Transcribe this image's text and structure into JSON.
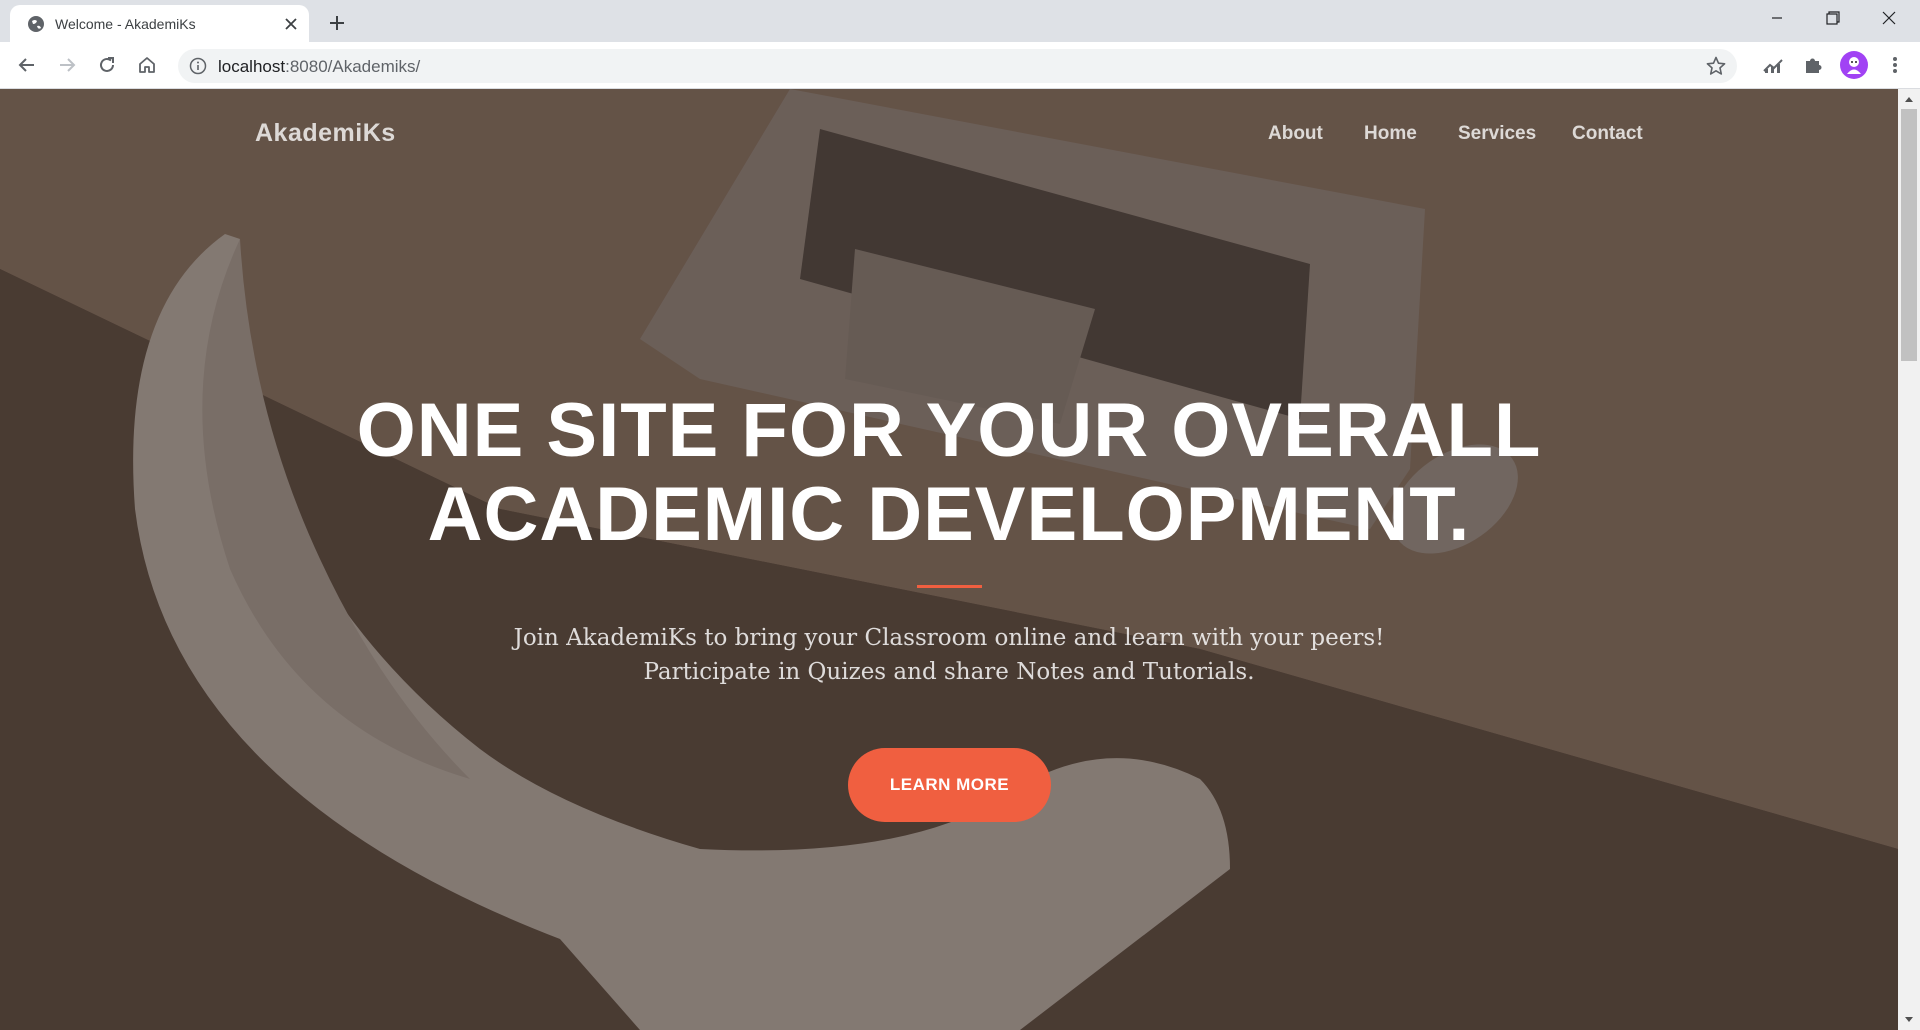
{
  "browser": {
    "tab_title": "Welcome - AkademiKs",
    "url_host": "localhost",
    "url_rest": ":8080/Akademiks/",
    "icons": [
      "globe-icon",
      "close-icon",
      "plus-icon",
      "minimize-icon",
      "restore-icon",
      "close-window-icon",
      "back-icon",
      "forward-icon",
      "reload-icon",
      "home-icon",
      "info-icon",
      "star-icon",
      "chart-extension-icon",
      "puzzle-icon",
      "profile-avatar",
      "menu-dots-icon"
    ]
  },
  "page": {
    "brand": "AkademiKs",
    "nav": [
      {
        "label": "About"
      },
      {
        "label": "Home"
      },
      {
        "label": "Services"
      },
      {
        "label": "Contact"
      }
    ],
    "hero": {
      "title_line1": "ONE SITE FOR YOUR OVERALL",
      "title_line2": "ACADEMIC DEVELOPMENT.",
      "subtitle_line1": "Join AkademiKs to bring your Classroom online and learn with your peers!",
      "subtitle_line2": "Participate in Quizes and share Notes and Tutorials.",
      "cta_label": "LEARN MORE"
    }
  },
  "colors": {
    "accent": "#f05f40",
    "overlay": "#46372f"
  }
}
